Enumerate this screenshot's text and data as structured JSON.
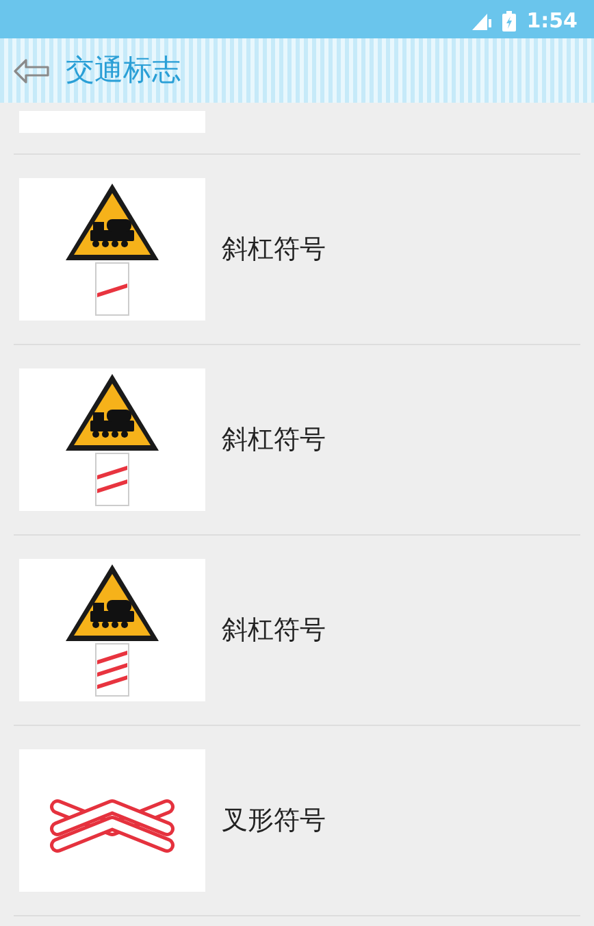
{
  "status_bar": {
    "time": "1:54"
  },
  "header": {
    "title": "交通标志"
  },
  "items": [
    {
      "kind": "one-bar",
      "label": "斜杠符号"
    },
    {
      "kind": "two-bar",
      "label": "斜杠符号"
    },
    {
      "kind": "three-bar",
      "label": "斜杠符号"
    },
    {
      "kind": "cross",
      "label": "叉形符号"
    }
  ]
}
